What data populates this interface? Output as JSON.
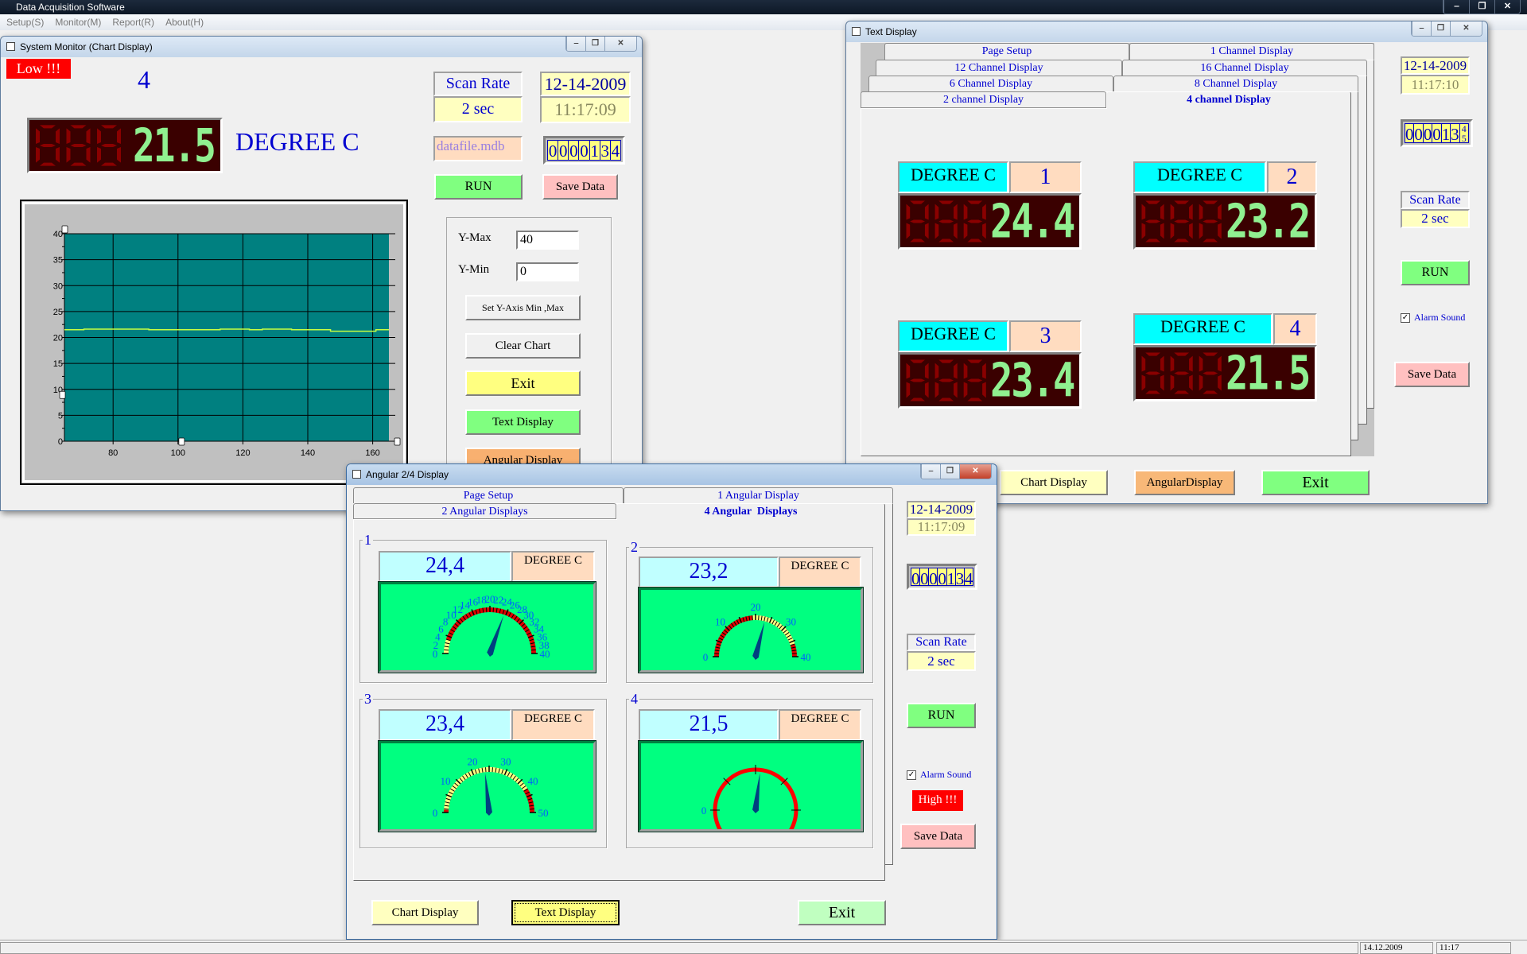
{
  "app": {
    "title": "Data Acquisition Software",
    "menu": [
      "Setup(S)",
      "Monitor(M)",
      "Report(R)",
      "About(H)"
    ],
    "window_controls": {
      "minimize": "‒",
      "restore": "❐",
      "close": "✕"
    },
    "status": {
      "date": "14.12.2009",
      "time": "11:17"
    }
  },
  "chart_window": {
    "title": "System Monitor (Chart Display)",
    "alarm_badge": "Low !!!",
    "channel": "4",
    "reading": "21.5",
    "unit": "DEGREE C",
    "scan_rate_label": "Scan Rate",
    "scan_rate_value": "2 sec",
    "date": "12-14-2009",
    "time": "11:17:09",
    "file": "datafile.mdb",
    "counter": [
      "0",
      "0",
      "0",
      "0",
      "1",
      "3",
      "4"
    ],
    "run": "RUN",
    "save": "Save Data",
    "ymax_label": "Y-Max",
    "ymax_value": "40",
    "ymin_label": "Y-Min",
    "ymin_value": "0",
    "set_axis": "Set Y-Axis Min ,Max",
    "clear_chart": "Clear Chart",
    "exit": "Exit",
    "text_display": "Text Display",
    "angular_display": "Angular Display",
    "colors": {
      "plot_bg": "#008080",
      "line": "#c8ff40",
      "alarm": "#ff0000"
    }
  },
  "chart_data": {
    "type": "line",
    "title": "",
    "xlabel": "",
    "ylabel": "",
    "xlim": [
      65,
      165
    ],
    "ylim": [
      0,
      40
    ],
    "xticks": [
      80,
      100,
      120,
      140,
      160
    ],
    "yticks": [
      0,
      5,
      10,
      15,
      20,
      25,
      30,
      35,
      40
    ],
    "grid": true,
    "series": [
      {
        "x": [
          65,
          71,
          90,
          91,
          113,
          120,
          122,
          126,
          132,
          135,
          146,
          147,
          160,
          161,
          165
        ],
        "y": [
          21.5,
          21.6,
          21.6,
          21.5,
          21.6,
          21.6,
          21.5,
          21.6,
          21.6,
          21.5,
          21.5,
          21.2,
          21.2,
          21.5,
          21.5
        ]
      }
    ]
  },
  "text_window": {
    "title": "Text Display",
    "tabs": [
      [
        "Page Setup",
        "1 Channel Display"
      ],
      [
        "12 Channel Display",
        "16 Channel Display"
      ],
      [
        "6 Channel Display",
        "8 Channel Display"
      ],
      [
        "2 channel Display",
        "4 channel Display"
      ]
    ],
    "active_tab": "4 channel Display",
    "channels": [
      {
        "unit": "DEGREE C",
        "num": "1",
        "reading": "24.4"
      },
      {
        "unit": "DEGREE C",
        "num": "2",
        "reading": "23.2"
      },
      {
        "unit": "DEGREE C",
        "num": "3",
        "reading": "23.4"
      },
      {
        "unit": "DEGREE C",
        "num": "4",
        "reading": "21.5"
      }
    ],
    "date": "12-14-2009",
    "time": "11:17:10",
    "counter": [
      "0",
      "0",
      "0",
      "0",
      "1",
      "3",
      "4"
    ],
    "counter_rolling_next": "5",
    "scan_rate_label": "Scan Rate",
    "scan_rate_value": "2 sec",
    "run": "RUN",
    "alarm_sound": "Alarm Sound",
    "alarm_checked": true,
    "save": "Save Data",
    "chart_display": "Chart Display",
    "angular_display": "AngularDisplay",
    "exit": "Exit"
  },
  "angular_window": {
    "title": "Angular 2/4 Display",
    "tabs": [
      [
        "Page Setup",
        "1 Angular Display"
      ],
      [
        "2 Angular Displays",
        "4 Angular  Displays"
      ]
    ],
    "active_tab": "4 Angular  Displays",
    "gauges": [
      {
        "num": "1",
        "value": "24,4",
        "reading": 24.4,
        "unit": "DEGREE C",
        "min": 0,
        "max": 40,
        "labels": [
          0,
          2,
          4,
          6,
          8,
          10,
          12,
          14,
          16,
          18,
          20,
          22,
          24,
          26,
          28,
          30,
          32,
          34,
          36,
          38,
          40
        ],
        "zones": [
          {
            "from": 0,
            "to": 4,
            "color": "#ffff80"
          },
          {
            "from": 4,
            "to": 40,
            "color": "#e00000"
          }
        ]
      },
      {
        "num": "2",
        "value": "23,2",
        "reading": 23.2,
        "unit": "DEGREE C",
        "min": 0,
        "max": 40,
        "labels": [
          0,
          10,
          20,
          30,
          40
        ],
        "zones": [
          {
            "from": 0,
            "to": 19,
            "color": "#e00000"
          },
          {
            "from": 19,
            "to": 36,
            "color": "#ffff80"
          },
          {
            "from": 36,
            "to": 40,
            "color": "#e00000"
          }
        ]
      },
      {
        "num": "3",
        "value": "23,4",
        "reading": 23.4,
        "unit": "DEGREE C",
        "min": 0,
        "max": 50,
        "labels": [
          0,
          10,
          20,
          30,
          40,
          50
        ],
        "zones": [
          {
            "from": 0,
            "to": 1,
            "color": "#e00000"
          },
          {
            "from": 1,
            "to": 41,
            "color": "#ffff80"
          },
          {
            "from": 41,
            "to": 50,
            "color": "#e00000"
          }
        ]
      },
      {
        "num": "4",
        "value": "21,5",
        "reading": 21.5,
        "unit": "DEGREE C",
        "min": 0,
        "max": 40,
        "labels": [
          0
        ],
        "zones": [],
        "full_circle": true
      }
    ],
    "date": "12-14-2009",
    "time": "11:17:09",
    "counter": [
      "0",
      "0",
      "0",
      "0",
      "1",
      "3",
      "4"
    ],
    "scan_rate_label": "Scan Rate",
    "scan_rate_value": "2 sec",
    "run": "RUN",
    "alarm_sound": "Alarm Sound",
    "alarm_checked": true,
    "alarm_badge": "High !!!",
    "save": "Save Data",
    "chart_display": "Chart Display",
    "text_display": "Text Display",
    "exit": "Exit"
  }
}
